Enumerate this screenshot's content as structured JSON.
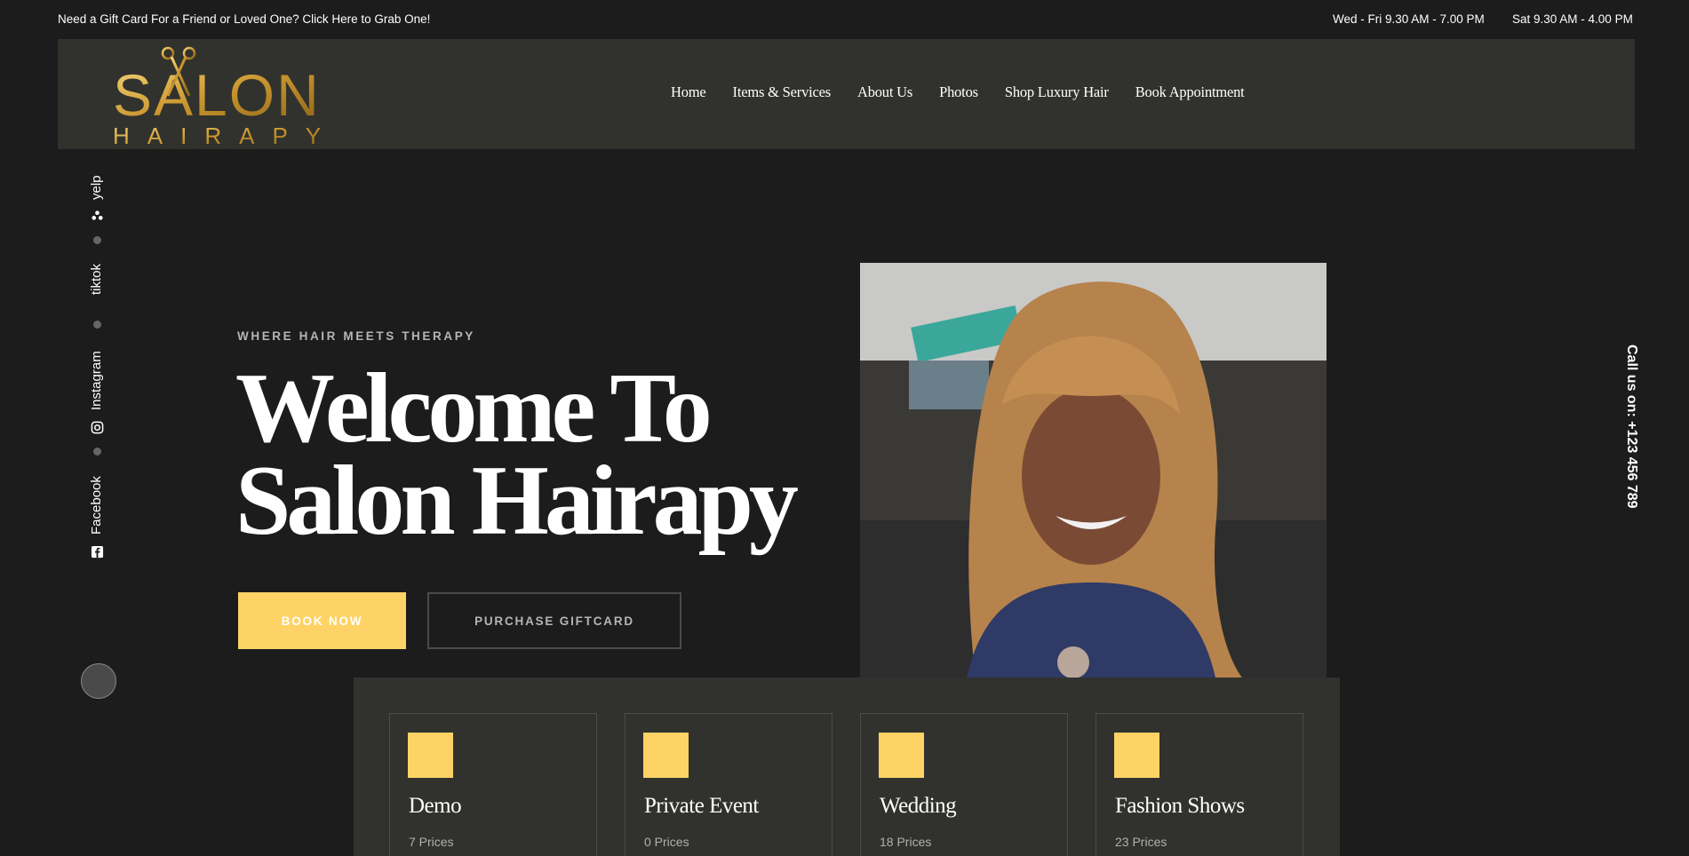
{
  "topbar": {
    "promo": "Need a Gift Card For a Friend or Loved One? Click Here to Grab One!",
    "hours_weekday": "Wed - Fri 9.30 AM - 7.00 PM",
    "hours_saturday": "Sat 9.30 AM - 4.00 PM"
  },
  "logo": {
    "word": "SALON",
    "sub": "HAIRAPY"
  },
  "nav": [
    "Home",
    "Items & Services",
    "About Us",
    "Photos",
    "Shop Luxury Hair",
    "Book Appointment"
  ],
  "social": [
    "yelp",
    "tiktok",
    "Instagram",
    "Facebook"
  ],
  "call": "Call us on:  +123 456 789",
  "hero": {
    "eyebrow": "WHERE HAIR MEETS THERAPY",
    "title_line1": "Welcome To",
    "title_line2": "Salon Hairapy",
    "book_label": "BOOK NOW",
    "gift_label": "PURCHASE GIFTCARD"
  },
  "cards": [
    {
      "title": "Demo",
      "prices": "7 Prices"
    },
    {
      "title": "Private Event",
      "prices": "0 Prices"
    },
    {
      "title": "Wedding",
      "prices": "18 Prices"
    },
    {
      "title": "Fashion Shows",
      "prices": "23 Prices"
    }
  ],
  "colors": {
    "accent": "#fdd366",
    "header_bg": "#31322d",
    "page_bg": "#1c1c1c"
  }
}
